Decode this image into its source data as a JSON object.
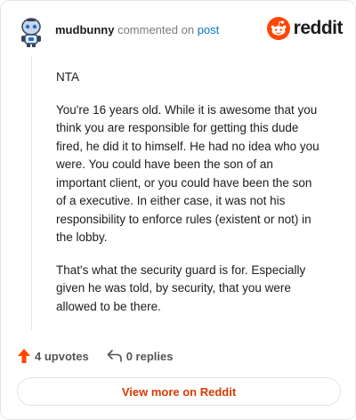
{
  "header": {
    "username": "mudbunny",
    "commented_text": "commented on",
    "post_link_label": "post",
    "brand_name": "reddit",
    "brand_color": "#ff4500",
    "avatar_icon": "snoo-robot-avatar"
  },
  "comment": {
    "paragraphs": [
      "NTA",
      "You're 16 years old. While it is awesome that you think you are responsible for getting this dude fired, he did it to himself. He had no idea who you were. You could have been the son of an important client, or you could have been the son of a executive. In either case, it was not his responsibility to enforce rules (existent or not) in the lobby.",
      "That's what the security guard is for. Especially given he was told, by security, that you were allowed to be there."
    ]
  },
  "actions": {
    "upvotes_label": "4 upvotes",
    "replies_label": "0 replies",
    "upvote_icon": "upvote-arrow-icon",
    "reply_icon": "reply-arrow-icon"
  },
  "footer": {
    "view_more_label": "View more on Reddit",
    "accent_color": "#d93a00"
  }
}
